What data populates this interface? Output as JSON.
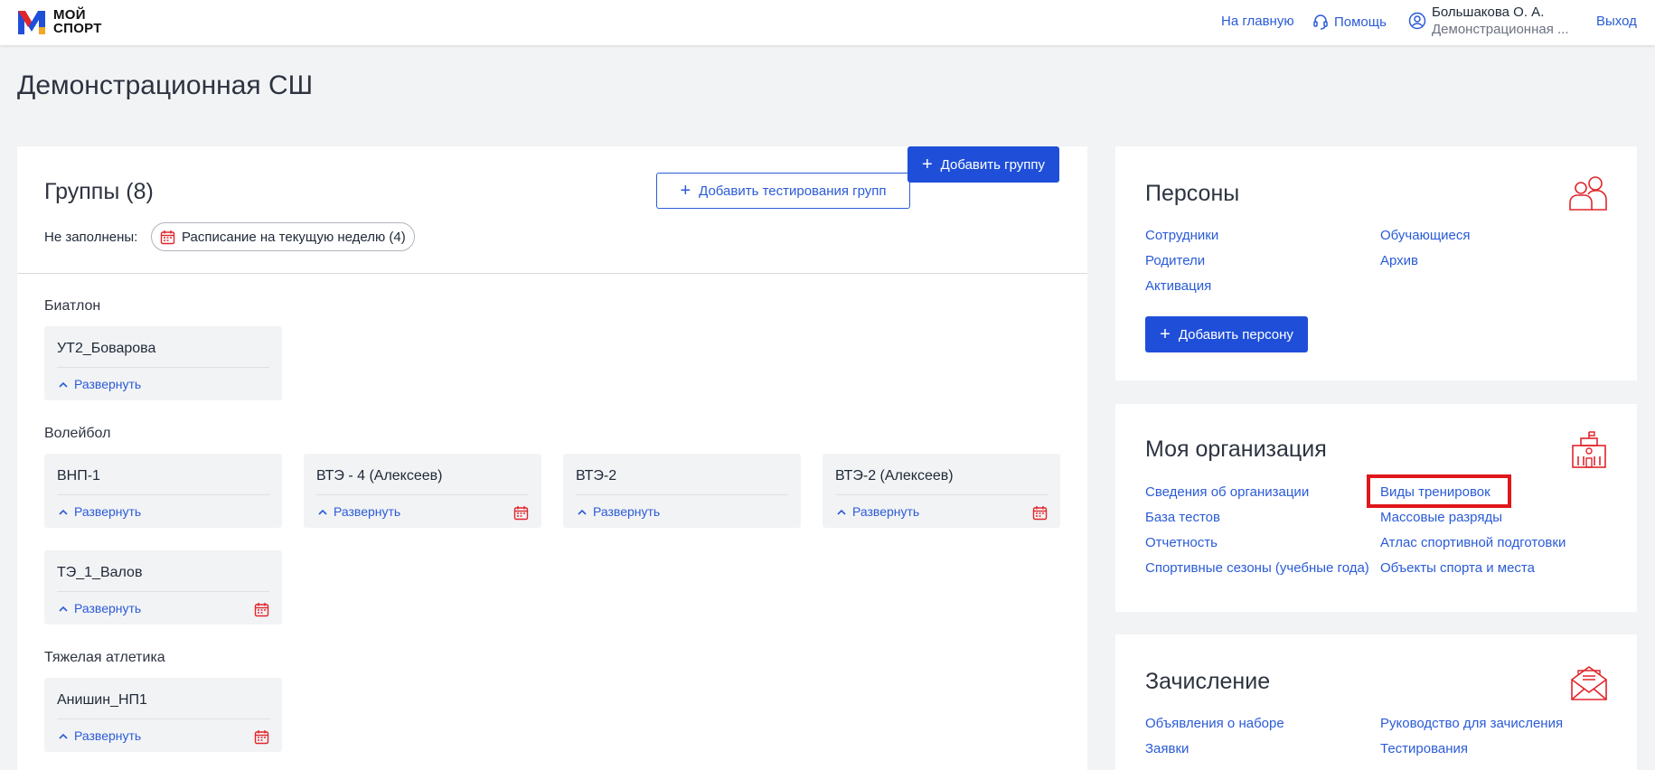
{
  "header": {
    "logo_text_line1": "МОЙ",
    "logo_text_line2": "СПОРТ",
    "home_link": "На главную",
    "help_link": "Помощь",
    "user_name": "Большакова О. А.",
    "user_org": "Демонстрационная ...",
    "logout": "Выход"
  },
  "page_title": "Демонстрационная СШ",
  "groups": {
    "title": "Группы (8)",
    "add_testing_button": "Добавить тестирования групп",
    "add_group_button": "Добавить группу",
    "unfilled_label": "Не заполнены:",
    "unfilled_chip": "Расписание на текущую неделю (4)",
    "sports": [
      {
        "name": "Биатлон",
        "groups": [
          {
            "name": "УТ2_Боварова",
            "expand": "Развернуть"
          }
        ]
      },
      {
        "name": "Волейбол",
        "groups": [
          {
            "name": "ВНП-1",
            "expand": "Развернуть"
          },
          {
            "name": "ВТЭ - 4 (Алексеев)",
            "expand": "Развернуть"
          },
          {
            "name": "ВТЭ-2",
            "expand": "Развернуть"
          },
          {
            "name": "ВТЭ-2 (Алексеев)",
            "expand": "Развернуть"
          },
          {
            "name": "ТЭ_1_Валов",
            "expand": "Развернуть"
          }
        ]
      },
      {
        "name": "Тяжелая атлетика",
        "groups": [
          {
            "name": "Анишин_НП1",
            "expand": "Развернуть"
          }
        ]
      }
    ]
  },
  "persons": {
    "title": "Персоны",
    "links": [
      "Сотрудники",
      "Обучающиеся",
      "Родители",
      "Архив",
      "Активация"
    ],
    "add_button": "Добавить персону"
  },
  "organization": {
    "title": "Моя организация",
    "links": [
      "Сведения об организации",
      "Виды тренировок",
      "База тестов",
      "Массовые разряды",
      "Отчетность",
      "Атлас спортивной подготовки",
      "Спортивные сезоны (учебные года)",
      "Объекты спорта и места"
    ]
  },
  "enrollment": {
    "title": "Зачисление",
    "links": [
      "Объявления о наборе",
      "Руководство для зачисления",
      "Заявки",
      "Тестирования"
    ]
  },
  "colors": {
    "accent": "#1f4fd8",
    "link": "#2a5bd7",
    "icon_red": "#e0252b",
    "highlight": "#e0161b"
  }
}
